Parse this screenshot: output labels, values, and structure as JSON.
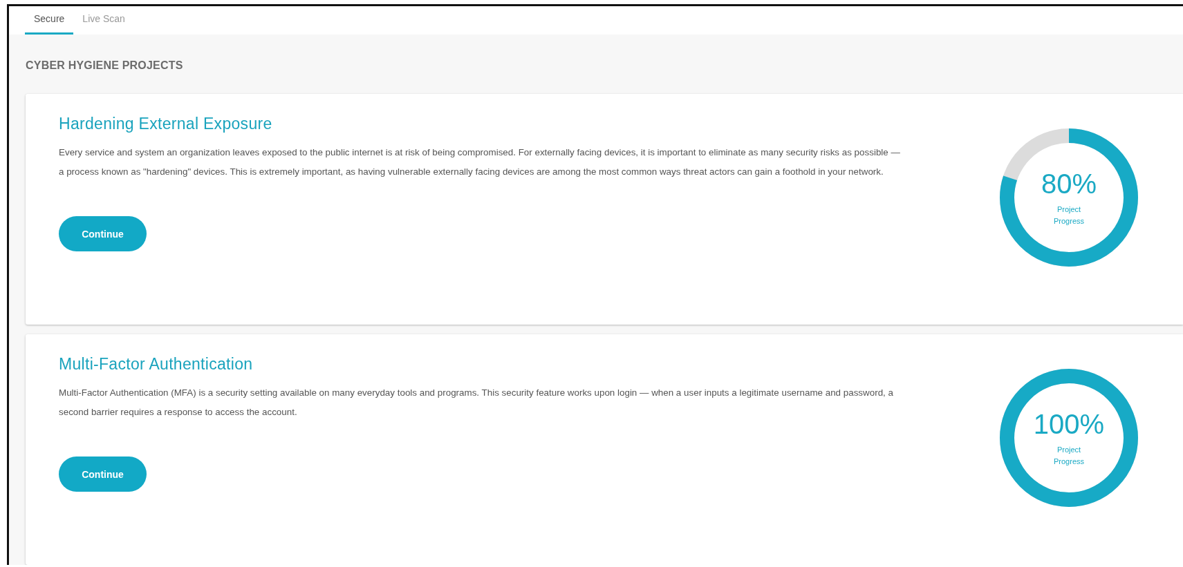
{
  "tabs": [
    {
      "label": "Secure",
      "selected": true
    },
    {
      "label": "Live Scan",
      "selected": false
    }
  ],
  "section_title": "CYBER HYGIENE PROJECTS",
  "projects": [
    {
      "title": "Hardening External Exposure",
      "description": "Every service and system an organization leaves exposed to the public internet is at risk of being compromised. For externally facing devices, it is important to eliminate as many security risks as possible — a process known as \"hardening\" devices. This is extremely important, as having vulnerable externally facing devices are among the most common ways threat actors can gain a foothold in your network.",
      "button": "Continue",
      "progress": {
        "value": "80%",
        "label": "Project Progress",
        "level": 0.8
      }
    },
    {
      "title": "Multi-Factor Authentication",
      "description": "Multi-Factor Authentication (MFA) is a security setting available on many everyday tools and programs. This security feature works upon login — when a user inputs a legitimate username and password, a second barrier requires a response to access the account.",
      "button": "Continue",
      "progress": {
        "value": "100%",
        "label": "Project Progress",
        "level": 1
      }
    }
  ]
}
